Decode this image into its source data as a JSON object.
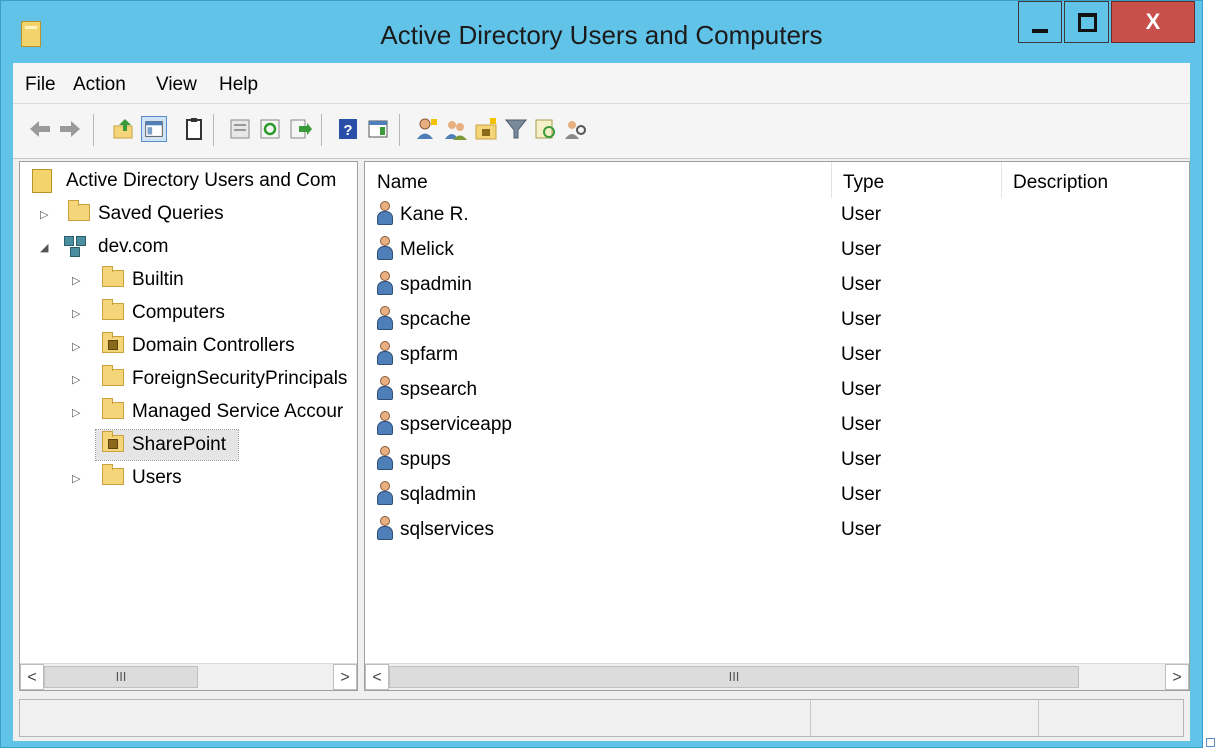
{
  "window": {
    "title": "Active Directory Users and Computers",
    "close_label": "X"
  },
  "menu": [
    {
      "label": "File"
    },
    {
      "label": "Action"
    },
    {
      "label": "View"
    },
    {
      "label": "Help"
    }
  ],
  "toolbar": {
    "icons": [
      "back-icon",
      "forward-icon",
      "up-one-level-icon",
      "show-hide-console-tree-icon",
      "properties-icon",
      "export-list-icon",
      "refresh-icon",
      "export-icon",
      "help-icon",
      "show-action-pane-icon",
      "create-user-icon",
      "create-group-icon",
      "create-ou-icon",
      "filter-icon",
      "find-icon",
      "add-to-group-icon"
    ]
  },
  "tree": {
    "root": "Active Directory Users and Com",
    "items": [
      {
        "label": "Saved Queries"
      },
      {
        "label": "dev.com"
      },
      {
        "label": "Builtin"
      },
      {
        "label": "Computers"
      },
      {
        "label": "Domain Controllers"
      },
      {
        "label": "ForeignSecurityPrincipals"
      },
      {
        "label": "Managed Service Accour"
      },
      {
        "label": "SharePoint"
      },
      {
        "label": "Users"
      }
    ],
    "scroll_glyph": "III"
  },
  "list": {
    "columns": [
      "Name",
      "Type",
      "Description"
    ],
    "rows": [
      {
        "name": "Kane R.",
        "type": "User"
      },
      {
        "name": "Melick",
        "type": "User"
      },
      {
        "name": "spadmin",
        "type": "User"
      },
      {
        "name": "spcache",
        "type": "User"
      },
      {
        "name": "spfarm",
        "type": "User"
      },
      {
        "name": "spsearch",
        "type": "User"
      },
      {
        "name": "spserviceapp",
        "type": "User"
      },
      {
        "name": "spups",
        "type": "User"
      },
      {
        "name": "sqladmin",
        "type": "User"
      },
      {
        "name": "sqlservices",
        "type": "User"
      }
    ],
    "scroll_glyph": "III"
  },
  "colors": {
    "title_bar": "#62c3e8",
    "close_button": "#c7504a"
  }
}
